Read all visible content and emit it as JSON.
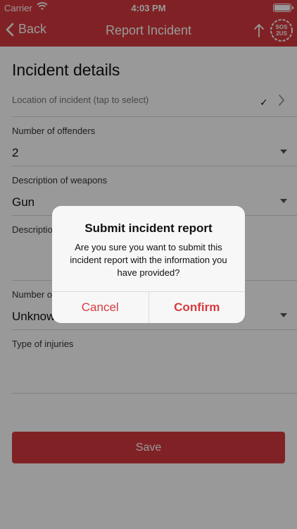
{
  "status_bar": {
    "carrier": "Carrier",
    "time": "4:03 PM"
  },
  "nav": {
    "back_label": "Back",
    "title": "Report Incident",
    "logo_text_top": "SOS",
    "logo_text_bottom": "2US"
  },
  "section_title": "Incident details",
  "fields": {
    "location": {
      "placeholder": "Location of incident (tap to select)"
    },
    "offenders": {
      "label": "Number of offenders",
      "value": "2"
    },
    "weapons": {
      "label": "Description of weapons",
      "value": "Gun"
    },
    "description": {
      "label": "Description"
    },
    "number_of": {
      "label": "Number o",
      "value": "Unknow"
    },
    "injuries": {
      "label": "Type of injuries"
    }
  },
  "save_label": "Save",
  "dialog": {
    "title": "Submit incident report",
    "message": "Are you sure you want to submit this incident report with the information you have provided?",
    "cancel_label": "Cancel",
    "confirm_label": "Confirm"
  },
  "colors": {
    "accent": "#d63a3f",
    "dialog_bg": "#f7f7f7"
  }
}
